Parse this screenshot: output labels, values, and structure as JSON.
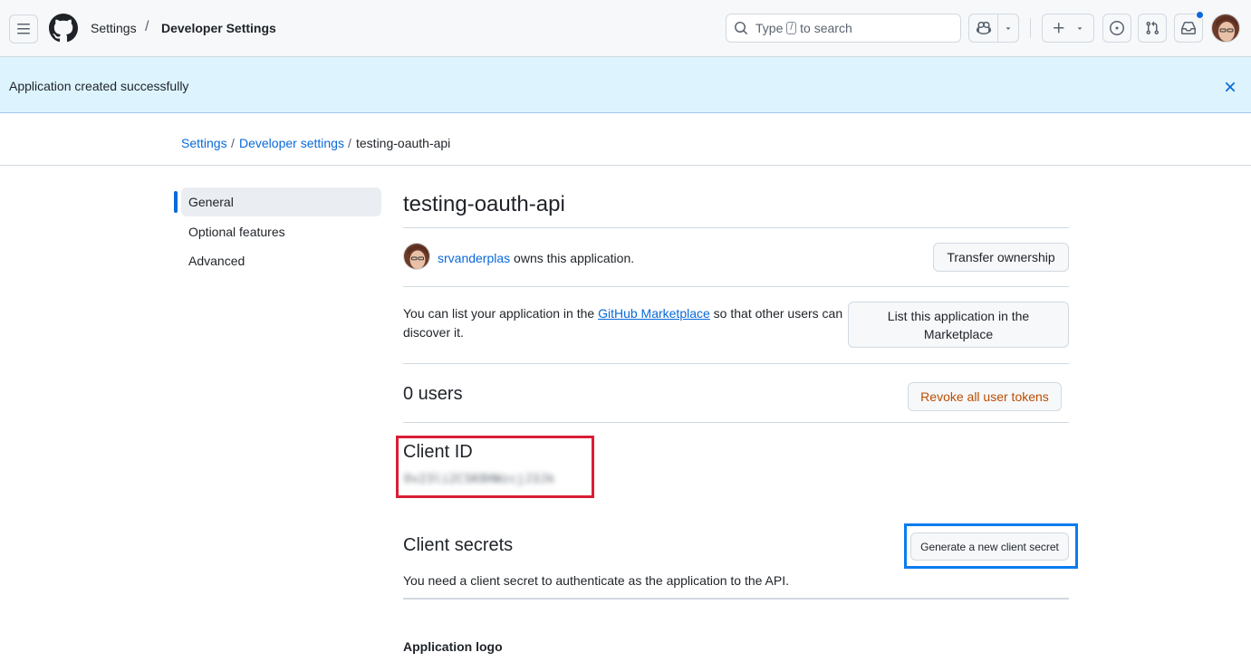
{
  "header": {
    "breadcrumb_settings": "Settings",
    "breadcrumb_separator": "/",
    "breadcrumb_current": "Developer Settings",
    "search_prefix": "Type",
    "search_key": "/",
    "search_suffix": "to search",
    "icons": [
      "menu-icon",
      "github-logo",
      "search-icon",
      "copilot-icon",
      "chevron-down-icon",
      "plus-icon",
      "issues-icon",
      "pull-request-icon",
      "inbox-icon"
    ]
  },
  "flash": {
    "message": "Application created successfully",
    "close_icon": "x-icon",
    "bg_color": "#ddf4ff"
  },
  "breadcrumb": {
    "items": [
      "Settings",
      "Developer settings",
      "testing-oauth-api"
    ],
    "separator": "/"
  },
  "sidebar": {
    "items": [
      {
        "label": "General"
      },
      {
        "label": "Optional features"
      },
      {
        "label": "Advanced"
      }
    ]
  },
  "main": {
    "title": "testing-oauth-api",
    "owner_name": "srvanderplas",
    "owner_suffix": " owns this application.",
    "transfer_button": "Transfer ownership",
    "marketplace_prefix": "You can list your application in the ",
    "marketplace_link": "GitHub Marketplace",
    "marketplace_suffix": " so that other users can discover it.",
    "marketplace_button": "List this application in the Marketplace",
    "users_count": "0 users",
    "revoke_button": "Revoke all user tokens",
    "client_id_label": "Client ID",
    "client_id_value": "Ov23li2CSK8HWzcjJ3Jk",
    "client_secrets_title": "Client secrets",
    "generate_button": "Generate a new client secret",
    "secrets_description": "You need a client secret to authenticate as the application to the API.",
    "logo_label": "Application logo"
  },
  "colors": {
    "accent": "#0969da",
    "highlight_red": "#d91e35",
    "highlight_blue": "#0a7cf0",
    "danger_text": "#bc4c00"
  }
}
